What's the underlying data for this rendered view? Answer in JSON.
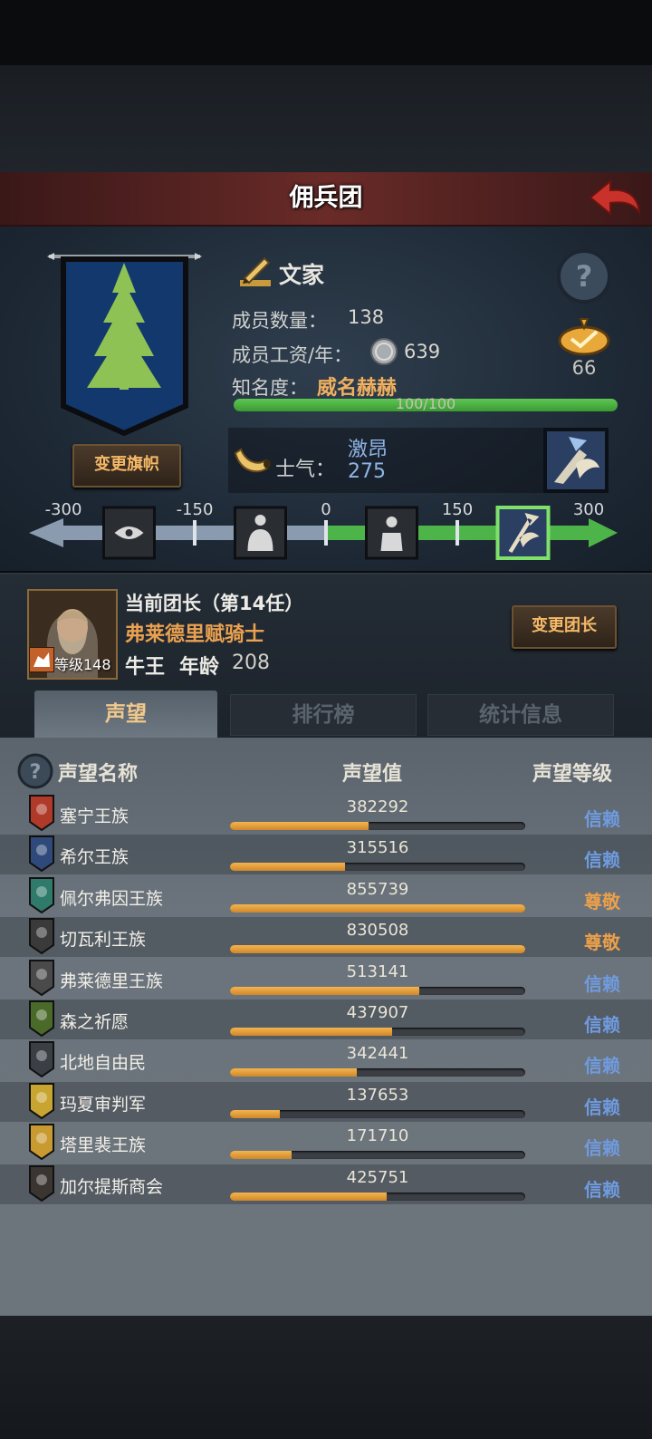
{
  "title": "佣兵团",
  "clan": {
    "name": "文家",
    "members_label": "成员数量：",
    "members_value": "138",
    "salary_label": "成员工资/年：",
    "salary_value": "639",
    "fame_label": "知名度：",
    "fame_value": "威名赫赫",
    "fame_progress_text": "100/100",
    "fame_progress_fraction": 1.0,
    "emblem_count": "66",
    "change_flag_label": "变更旗帜",
    "morale_label": "士气：",
    "morale_state": "激昂",
    "morale_value": "275"
  },
  "morale_scale": {
    "ticks": [
      "-300",
      "-150",
      "0",
      "150",
      "300"
    ],
    "current": 275,
    "min": -300,
    "max": 300
  },
  "leader": {
    "heading": "当前团长（第14任）",
    "name": "弗莱德里赋骑士",
    "level_text": "等级148",
    "title": "牛王",
    "age_label": "年龄",
    "age_value": "208",
    "change_label": "变更团长"
  },
  "tabs": [
    "声望",
    "排行榜",
    "统计信息"
  ],
  "list_headers": {
    "name": "声望名称",
    "value": "声望值",
    "level": "声望等级"
  },
  "colors": {
    "trust": "#6f9be0",
    "respect": "#eaa04a",
    "accent_gold": "#f0b060",
    "bar_fill": "#e09a3a"
  },
  "factions": [
    {
      "name": "塞宁王族",
      "value": "382292",
      "fraction": 0.47,
      "level": "信赖",
      "level_kind": "trust",
      "crest_color": "#b03a2a"
    },
    {
      "name": "希尔王族",
      "value": "315516",
      "fraction": 0.39,
      "level": "信赖",
      "level_kind": "trust",
      "crest_color": "#2f4a7a"
    },
    {
      "name": "佩尔弗因王族",
      "value": "855739",
      "fraction": 1.0,
      "level": "尊敬",
      "level_kind": "respect",
      "crest_color": "#2f7a6a"
    },
    {
      "name": "切瓦利王族",
      "value": "830508",
      "fraction": 1.0,
      "level": "尊敬",
      "level_kind": "respect",
      "crest_color": "#3a3a3a"
    },
    {
      "name": "弗莱德里王族",
      "value": "513141",
      "fraction": 0.64,
      "level": "信赖",
      "level_kind": "trust",
      "crest_color": "#4a4a4a"
    },
    {
      "name": "森之祈愿",
      "value": "437907",
      "fraction": 0.55,
      "level": "信赖",
      "level_kind": "trust",
      "crest_color": "#4a6a2a"
    },
    {
      "name": "北地自由民",
      "value": "342441",
      "fraction": 0.43,
      "level": "信赖",
      "level_kind": "trust",
      "crest_color": "#3a3f45"
    },
    {
      "name": "玛夏审判军",
      "value": "137653",
      "fraction": 0.17,
      "level": "信赖",
      "level_kind": "trust",
      "crest_color": "#c8a530"
    },
    {
      "name": "塔里裴王族",
      "value": "171710",
      "fraction": 0.21,
      "level": "信赖",
      "level_kind": "trust",
      "crest_color": "#c89a30"
    },
    {
      "name": "加尔提斯商会",
      "value": "425751",
      "fraction": 0.53,
      "level": "信赖",
      "level_kind": "trust",
      "crest_color": "#3a3530"
    }
  ]
}
